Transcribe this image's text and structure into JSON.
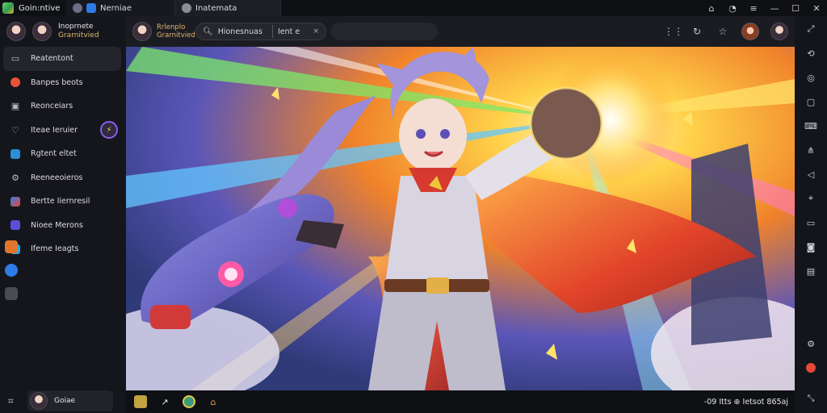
{
  "titlebar": {
    "app_name": "Goin:ntive",
    "tabs": [
      {
        "label": "Nerniae"
      },
      {
        "label": "Inatemata"
      }
    ]
  },
  "sidebar": {
    "profile": {
      "name": "Inoprnete",
      "subtitle": "Grarnitvied"
    },
    "items": [
      {
        "label": "Reatentont",
        "icon": "gamepad-icon"
      },
      {
        "label": "Banpes beots",
        "icon": "fire-icon"
      },
      {
        "label": "Reonceiars",
        "icon": "grid-icon"
      },
      {
        "label": "Iteae Ieruier",
        "icon": "heart-icon"
      },
      {
        "label": "Rgtent eltet",
        "icon": "media-icon"
      },
      {
        "label": "Reeneeoieros",
        "icon": "settings-icon"
      },
      {
        "label": "Bertte Iiernresil",
        "icon": "rocket-icon"
      },
      {
        "label": "Nioee Merons",
        "icon": "star-icon"
      },
      {
        "label": "Ifeme Ieagts",
        "icon": "chat-icon"
      }
    ],
    "badge": "⚡",
    "user": {
      "label": "Goiae"
    }
  },
  "toolbar": {
    "channel": "Rrlenplo Grarnitvied",
    "search_query": "Hionesnuas",
    "search_tag": "Ient e",
    "search_clear": "×"
  },
  "statusbar": {
    "text": "-09 Itts  ⊕ Ietsot 865aj"
  },
  "colors": {
    "accent": "#8a5cf0",
    "gold": "#e2b46f",
    "background": "#121318"
  }
}
